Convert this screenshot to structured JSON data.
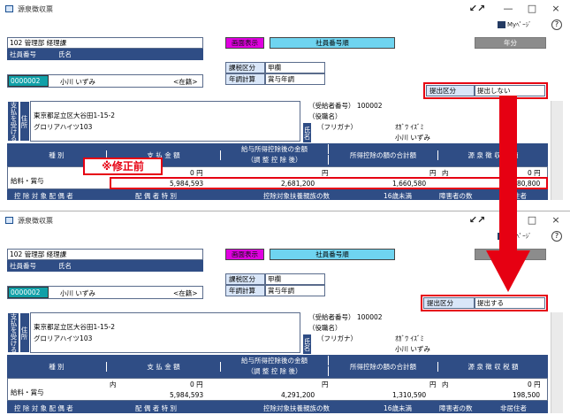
{
  "window": {
    "title": "源泉徴収票",
    "mypage": "Myﾍﾟｰｼﾞ",
    "help": "?",
    "minimize": "—",
    "maximize": "□",
    "close": "×",
    "resize": "↙↗"
  },
  "header": {
    "dept": "102 管理部 経理課",
    "emp_no_label": "社員番号",
    "name_label": "氏名",
    "emp_id": "0000002",
    "emp_name": "小川 いずみ",
    "status": "<在籍>",
    "display_btn": "画面表示",
    "sort_field": "社員番号順",
    "year_btn": "年分",
    "tax_cat_label": "課税区分",
    "tax_cat_value": "甲欄",
    "year_end_label": "年調計算",
    "year_end_value": "賞与年調",
    "submit_label": "提出区分"
  },
  "payee": {
    "v_label": "支払を受ける者",
    "addr_label": "住所",
    "address1": "東京都足立区大谷田1-15-2",
    "address2": "グロリアハイツ103",
    "recipient_no": "（受給者番号） 100002",
    "title_label": "（役職名）",
    "name_v_label": "氏名",
    "furigana_label": "（フリガナ）",
    "furigana": "ｵｶﾞﾜ ｲｽﾞﾐ",
    "kanji_name": "小川 いずみ"
  },
  "table": {
    "col_type": "種 別",
    "col_pay": "支 払 金 額",
    "col_salary_deduct_1": "給与所得控除後の金額",
    "col_salary_deduct_2": "（調 整 控 除 後）",
    "col_total_deduct": "所得控除の額の合計額",
    "col_tax": "源 泉 徴 収 税 額",
    "inner_label": "内",
    "unit": "円",
    "row_type": "給料・賞与",
    "footer1": "控 除 対 象 配 偶 者",
    "footer2": "配 偶 者 特 別",
    "footer3": "控除対象扶養親族の数",
    "footer4": "16歳未満",
    "footer5": "障害者の数",
    "footer6": "非居住者"
  },
  "before": {
    "submit_value": "提出しない",
    "payment": "5,984,593",
    "after_deduct": "2,681,200",
    "total_deduct": "1,660,580",
    "tax_inner": "0",
    "tax": "80,800",
    "callout": "※修正前"
  },
  "after": {
    "submit_value": "提出する",
    "payment": "5,984,593",
    "after_deduct": "4,291,200",
    "total_deduct": "1,310,590",
    "tax_inner": "0",
    "tax": "198,500"
  }
}
